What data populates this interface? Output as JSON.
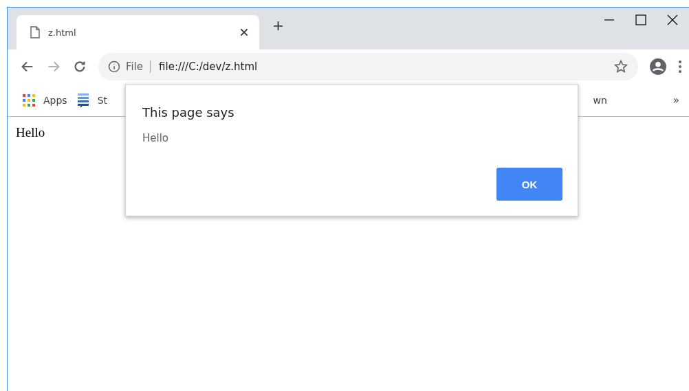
{
  "tabs": [
    {
      "title": "z.html",
      "selected": true
    }
  ],
  "new_tab": "+",
  "address": {
    "scheme_label": "File",
    "url": "file:///C:/dev/z.html"
  },
  "bookmarks": [
    {
      "label": "Apps",
      "kind": "apps"
    },
    {
      "label": "St",
      "kind": "stack"
    },
    {
      "label": "wn",
      "kind": "plain"
    }
  ],
  "bookmarks_more": "»",
  "page_text": "Hello",
  "dialog": {
    "title": "This page says",
    "message": "Hello",
    "button": "OK"
  }
}
